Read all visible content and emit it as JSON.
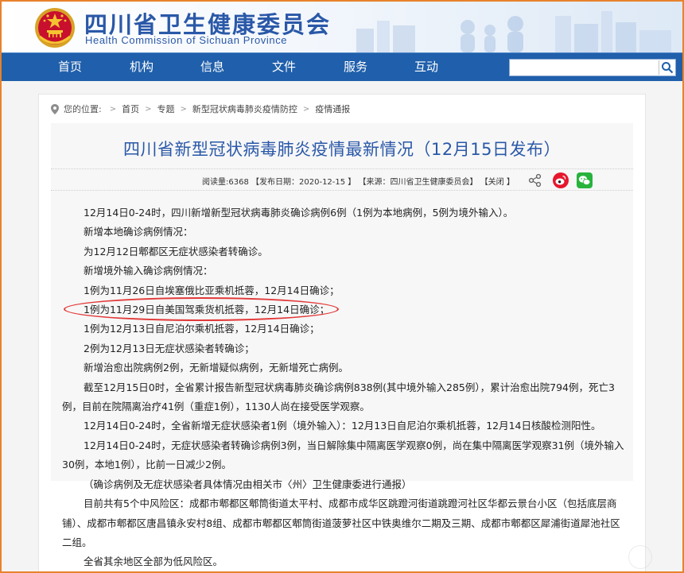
{
  "header": {
    "title": "四川省卫生健康委员会",
    "subtitle": "Health Commission of Sichuan Province"
  },
  "nav": {
    "items": [
      "首页",
      "机构",
      "信息",
      "文件",
      "服务",
      "互动"
    ],
    "search_placeholder": ""
  },
  "breadcrumb": {
    "label": "您的位置:",
    "items": [
      "首页",
      "专题",
      "新型冠状病毒肺炎疫情防控",
      "疫情通报"
    ]
  },
  "article": {
    "title": "四川省新型冠状病毒肺炎疫情最新情况（12月15日发布）",
    "meta": {
      "reads": "阅读量:6368",
      "date": "【发布日期：2020-12-15 】",
      "source": "【来源：四川省卫生健康委员会】",
      "close": "【关闭 】"
    },
    "paragraphs": [
      "12月14日0-24时，四川新增新型冠状病毒肺炎确诊病例6例（1例为本地病例，5例为境外输入）。",
      "新增本地确诊病例情况：",
      "为12月12日郫都区无症状感染者转确诊。",
      "新增境外输入确诊病例情况：",
      "1例为11月26日自埃塞俄比亚乘机抵蓉，12月14日确诊；",
      "1例为11月29日自美国驾乘货机抵蓉，12月14日确诊；",
      "1例为12月13日自尼泊尔乘机抵蓉，12月14日确诊；",
      "2例为12月13日无症状感染者转确诊；",
      "新增治愈出院病例2例，无新增疑似病例，无新增死亡病例。",
      "截至12月15日0时，全省累计报告新型冠状病毒肺炎确诊病例838例(其中境外输入285例），累计治愈出院794例，死亡3例，目前在院隔离治疗41例（重症1例），1130人尚在接受医学观察。",
      "12月14日0-24时，全省新增无症状感染者1例（境外输入）：12月13日自尼泊尔乘机抵蓉，12月14日核酸检测阳性。",
      "12月14日0-24时，无症状感染者转确诊病例3例，当日解除集中隔离医学观察0例，尚在集中隔离医学观察31例（境外输入30例，本地1例），比前一日减少2例。",
      "（确诊病例及无症状感染者具体情况由相关市〈州〉卫生健康委进行通报）",
      "目前共有5个中风险区：成都市郫都区郫筒街道太平村、成都市成华区跳蹬河街道跳蹬河社区华都云景台小区（包括底层商铺）、成都市郫都区唐昌镇永安村8组、成都市郫都区郫筒街道菠萝社区中铁奥维尔二期及三期、成都市郫都区犀浦街道犀池社区二组。",
      "全省其余地区全部为低风险区。"
    ]
  },
  "colors": {
    "brand_blue": "#2a58a8",
    "nav_blue": "#1f5fab",
    "highlight_red": "#e23838",
    "frame_orange": "#e8822c"
  },
  "icons": {
    "emblem": "national-emblem-icon",
    "search": "search-icon",
    "location": "location-pin-icon",
    "share": "share-icon",
    "weibo": "weibo-icon",
    "wechat": "wechat-icon"
  }
}
